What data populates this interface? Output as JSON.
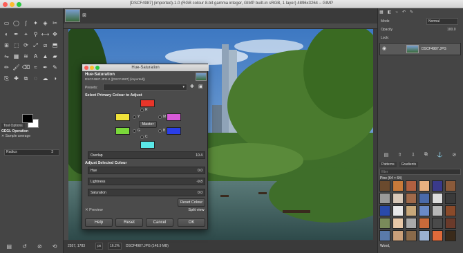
{
  "window": {
    "title": "[DSCF4987] (imported)-1.0 (RGB colour 8-bit gamma integer, GIMP built-in sRGB, 1 layer) 4896x3264 – GIMP"
  },
  "toolbox": {
    "icons": [
      "rect-select",
      "ellipse-select",
      "free-select",
      "fuzzy-select",
      "select-by-color",
      "scissors",
      "foreground-select",
      "paths",
      "color-picker",
      "zoom",
      "measure",
      "move",
      "align",
      "crop",
      "rotate",
      "scale",
      "shear",
      "perspective",
      "flip",
      "cage",
      "warp",
      "text",
      "bucket-fill",
      "blend",
      "pencil",
      "paintbrush",
      "eraser",
      "airbrush",
      "ink",
      "mypaint",
      "clone",
      "heal",
      "perspective-clone",
      "blur",
      "smudge",
      "dodge"
    ],
    "fg_color": "#000000",
    "bg_color": "#ffffff",
    "panel_tab": "Tool Options",
    "gegl_title": "GEGL Operation",
    "sample_label": "Sample average",
    "radius_label": "Radius",
    "radius_value": "3"
  },
  "canvas": {
    "status_coords": "2557, 1783",
    "status_unit": "px",
    "status_zoom": "16.2%",
    "status_file": "DSCF4987.JPG (148.9 MB)"
  },
  "right": {
    "mode_label": "Mode",
    "mode_value": "Normal",
    "opacity_label": "Opacity",
    "opacity_value": "100.0",
    "lock_label": "Lock:",
    "layer_name": "DSCF4987.JPG",
    "tabs": [
      "Patterns",
      "Gradients"
    ],
    "filter_placeholder": "filter",
    "pattern_title": "Pine (64 × 64)",
    "pattern_footer": "Wood,"
  },
  "dialog": {
    "title": "Hue-Saturation",
    "header": "Hue-Saturation",
    "subheader": "DSCF4987.JPG-2 ([DSCF4987] (imported))",
    "presets_label": "Presets:",
    "select_heading": "Select Primary Colour to Adjust",
    "labels": {
      "r": "R",
      "y": "Y",
      "m": "M",
      "g": "G",
      "b": "B",
      "c": "C"
    },
    "master_label": "Master",
    "overlap_label": "Overlap",
    "overlap_value": "10.4",
    "adjust_heading": "Adjust Selected Colour",
    "hue_label": "Hue",
    "hue_value": "0.0",
    "lightness_label": "Lightness",
    "lightness_value": "-9.8",
    "saturation_label": "Saturation",
    "saturation_value": "0.0",
    "reset_colour": "Reset Colour",
    "preview_label": "Preview",
    "split_view": "Split view",
    "help": "Help",
    "reset": "Reset",
    "cancel": "Cancel",
    "ok": "OK",
    "colors": {
      "r": "#e8352a",
      "y": "#f0e23a",
      "m": "#d85ad8",
      "g": "#7ad83a",
      "b": "#2a3ee8",
      "c": "#5ae8e8"
    }
  }
}
